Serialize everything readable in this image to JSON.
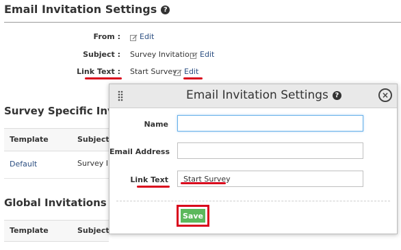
{
  "page": {
    "title": "Email Invitation Settings"
  },
  "fields": {
    "from_label": "From :",
    "subject_label": "Subject :",
    "subject_value": "Survey Invitation",
    "link_text_label": "Link Text :",
    "link_text_value": "Start Survey",
    "edit_label": "Edit"
  },
  "survey_section": {
    "title": "Survey Specific Invita",
    "columns": [
      "Template",
      "Subject"
    ],
    "rows": [
      {
        "template": "Default",
        "subject": "Survey In"
      }
    ]
  },
  "global_section": {
    "title": "Global Invitations",
    "columns": [
      "Template",
      "Subject"
    ]
  },
  "modal": {
    "title": "Email Invitation Settings",
    "name_label": "Name",
    "name_value": "",
    "email_label": "Email Address",
    "email_value": "",
    "link_text_label": "Link Text",
    "link_text_value": "Start Survey",
    "save_label": "Save",
    "close_symbol": "×"
  },
  "colors": {
    "accent_red": "#d9001b",
    "link_blue": "#2a4d80",
    "save_green": "#5cb85c"
  }
}
